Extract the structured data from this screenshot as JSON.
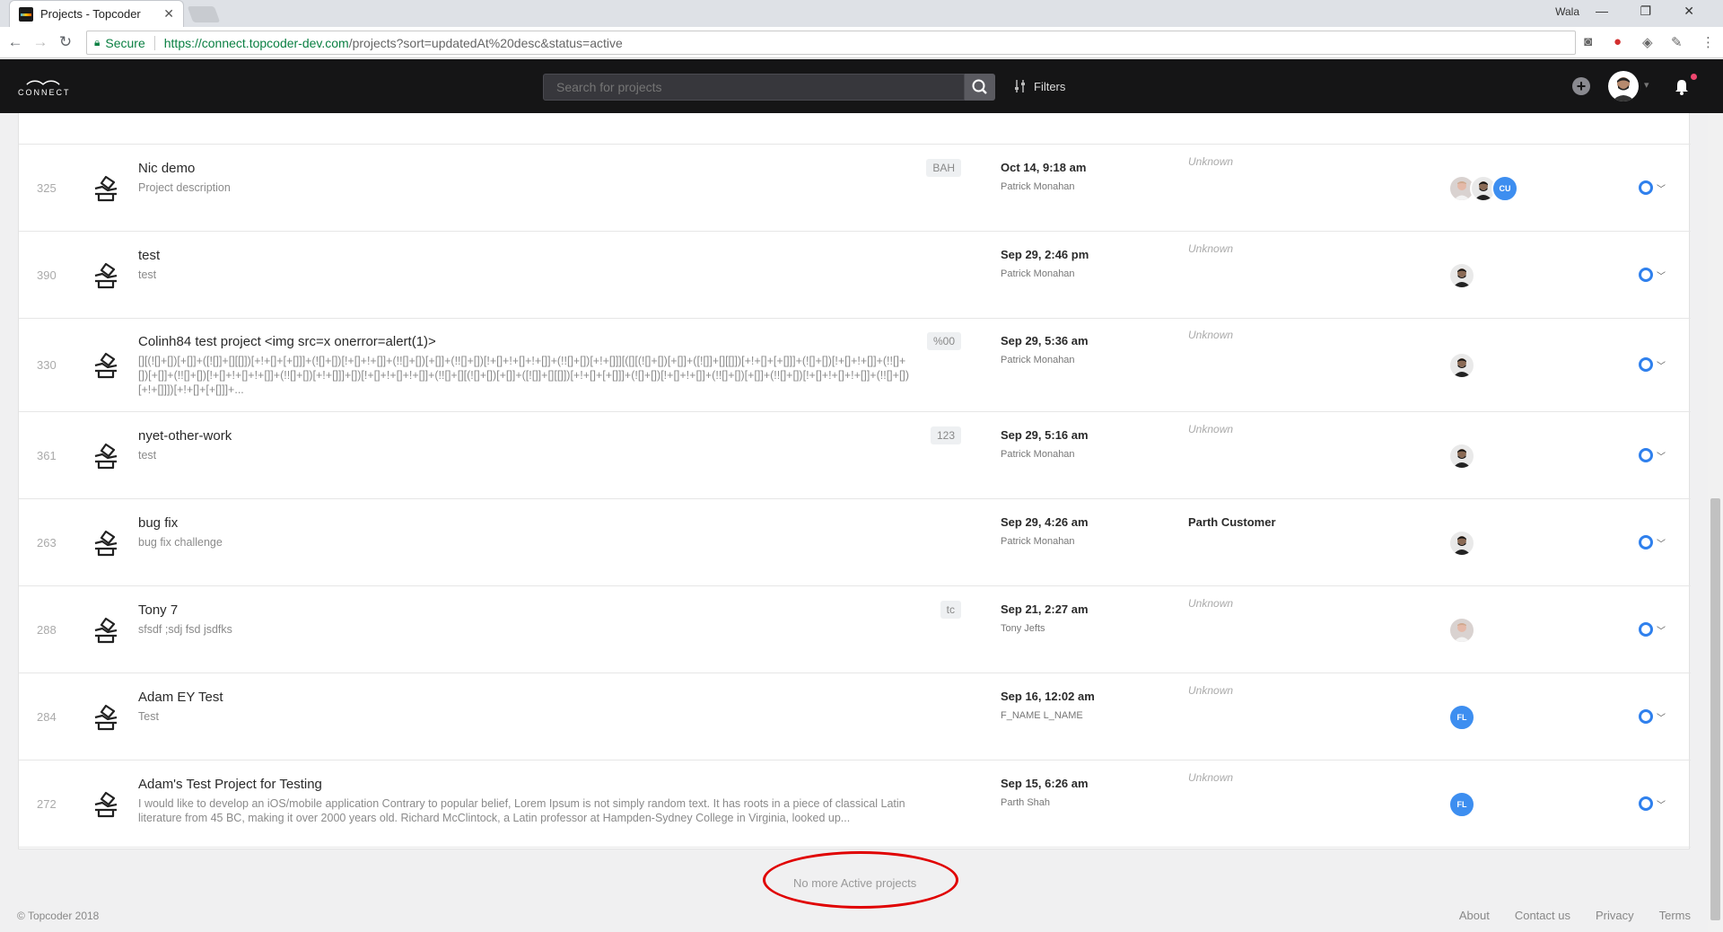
{
  "browser": {
    "tab_title": "Projects - Topcoder",
    "tab_close": "✕",
    "window_user": "Wala",
    "secure_label": "Secure",
    "url_host": "https://connect.topcoder-dev.com",
    "url_path": "/projects?sort=updatedAt%20desc&status=active"
  },
  "header": {
    "logo_text": "CONNECT",
    "search_placeholder": "Search for projects",
    "filters_label": "Filters"
  },
  "projects": [
    {
      "id": "325",
      "name": "Nic demo",
      "desc": "Project description",
      "tag": "BAH",
      "date": "Oct 14, 9:18 am",
      "updated_by": "Patrick Monahan",
      "customer": "Unknown",
      "team": [
        "photo1",
        "photo2",
        "CU"
      ]
    },
    {
      "id": "390",
      "name": "test",
      "desc": "test",
      "tag": "",
      "date": "Sep 29, 2:46 pm",
      "updated_by": "Patrick Monahan",
      "customer": "Unknown",
      "team": [
        "photo2"
      ]
    },
    {
      "id": "330",
      "name": "Colinh84 test project <img src=x onerror=alert(1)>",
      "desc": "[][(![]+[])[+[]]+([![]]+[][[]])[+!+[]+[+[]]]+(![]+[])[!+[]+!+[]]+(!![]+[])[+[]]+(!![]+[])[!+[]+!+[]+!+[]]+(!![]+[])[+!+[]]][([][(![]+[])[+[]]+([![]]+[][[]])[+!+[]+[+[]]]+(![]+[])[!+[]+!+[]]+(!![]+[])[+[]]+(!![]+[])[!+[]+!+[]+!+[]]+(!![]+[])[+!+[]]]+[])[!+[]+!+[]+!+[]]+(!![]+[][(![]+[])[+[]]+([![]]+[][[]])[+!+[]+[+[]]]+(![]+[])[!+[]+!+[]]+(!![]+[])[+[]]+(!![]+[])[!+[]+!+[]+!+[]]+(!![]+[])[+!+[]]])[+!+[]+[+[]]]+...",
      "tag": "%00",
      "date": "Sep 29, 5:36 am",
      "updated_by": "Patrick Monahan",
      "customer": "Unknown",
      "team": [
        "photo2"
      ]
    },
    {
      "id": "361",
      "name": "nyet-other-work",
      "desc": "test",
      "tag": "123",
      "date": "Sep 29, 5:16 am",
      "updated_by": "Patrick Monahan",
      "customer": "Unknown",
      "team": [
        "photo2"
      ]
    },
    {
      "id": "263",
      "name": "bug fix",
      "desc": "bug fix challenge",
      "tag": "",
      "date": "Sep 29, 4:26 am",
      "updated_by": "Patrick Monahan",
      "customer": "Parth Customer",
      "team": [
        "photo2"
      ]
    },
    {
      "id": "288",
      "name": "Tony 7",
      "desc": "sfsdf ;sdj fsd jsdfks",
      "tag": "tc",
      "date": "Sep 21, 2:27 am",
      "updated_by": "Tony Jefts",
      "customer": "Unknown",
      "team": [
        "photo1"
      ]
    },
    {
      "id": "284",
      "name": "Adam EY Test",
      "desc": "Test",
      "tag": "",
      "date": "Sep 16, 12:02 am",
      "updated_by": "F_NAME L_NAME",
      "customer": "Unknown",
      "team": [
        "FL"
      ]
    },
    {
      "id": "272",
      "name": "Adam's Test Project for Testing",
      "desc": "I would like to develop an iOS/mobile application Contrary to popular belief, Lorem Ipsum is not simply random text. It has roots in a piece of classical Latin literature from 45 BC, making it over 2000 years old. Richard McClintock, a Latin professor at Hampden-Sydney College in Virginia, looked up...",
      "tag": "",
      "date": "Sep 15, 6:26 am",
      "updated_by": "Parth Shah",
      "customer": "Unknown",
      "team": [
        "FL"
      ]
    }
  ],
  "footer": {
    "no_more": "No more Active projects",
    "copyright": "© Topcoder 2018",
    "links": [
      "About",
      "Contact us",
      "Privacy",
      "Terms"
    ]
  },
  "colors": {
    "status_ring": "#2f80ed",
    "annotation": "#e00000",
    "header_bg": "#151516"
  }
}
